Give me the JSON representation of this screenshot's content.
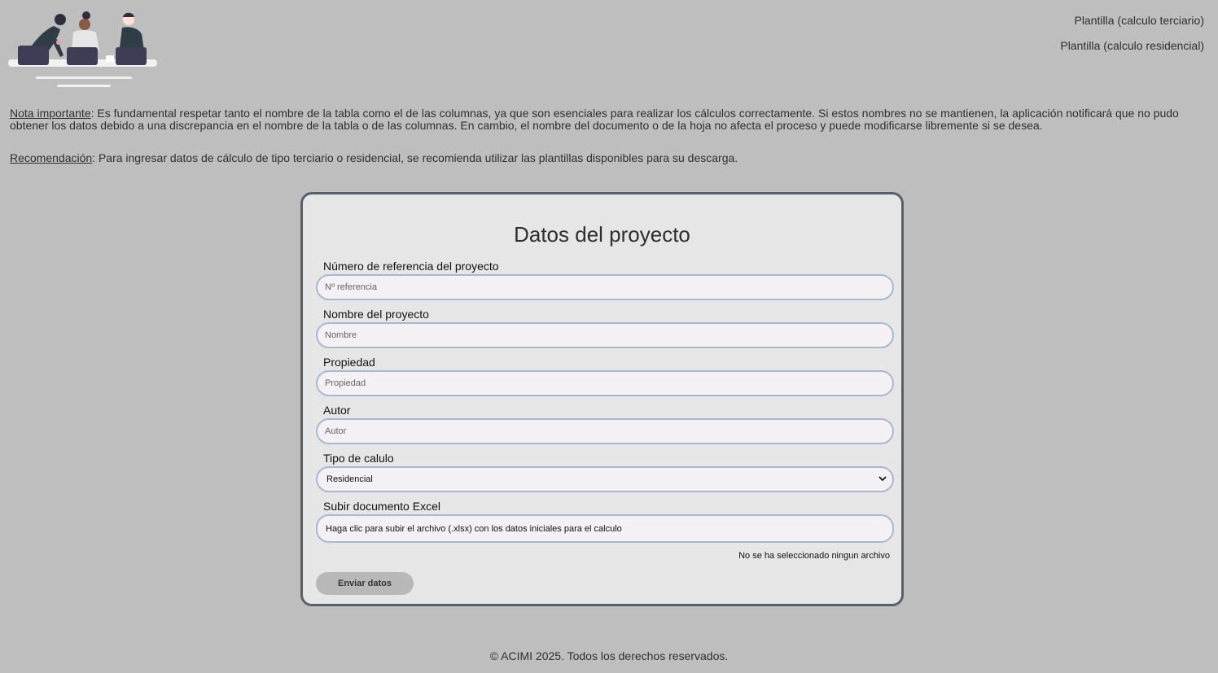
{
  "header": {
    "template_links": [
      "Plantilla (calculo terciario)",
      "Plantilla (calculo residencial)"
    ]
  },
  "notes": {
    "important_label": "Nota importante",
    "important_text": ": Es fundamental respetar tanto el nombre de la tabla como el de las columnas, ya que son esenciales para realizar los cálculos correctamente. Si estos nombres no se mantienen, la aplicación notificará que no pudo obtener los datos debido a una discrepancia en el nombre de la tabla o de las columnas. En cambio, el nombre del documento o de la hoja no afecta el proceso y puede modificarse libremente si se desea.",
    "recommendation_label": "Recomendación",
    "recommendation_text": ": Para ingresar datos de cálculo de tipo terciario o residencial, se recomienda utilizar las plantillas disponibles para su descarga."
  },
  "form": {
    "title": "Datos del proyecto",
    "fields": [
      {
        "label": "Número de referencia del proyecto",
        "placeholder": "Nº referencia",
        "value": ""
      },
      {
        "label": "Nombre del proyecto",
        "placeholder": "Nombre",
        "value": ""
      },
      {
        "label": "Propiedad",
        "placeholder": "Propiedad",
        "value": ""
      },
      {
        "label": "Autor",
        "placeholder": "Autor",
        "value": ""
      }
    ],
    "calc_type": {
      "label": "Tipo de calulo",
      "selected": "Residencial"
    },
    "upload": {
      "label": "Subir documento Excel",
      "prompt": "Haga clic para subir el archivo (.xlsx) con los datos iniciales para el calculo",
      "status": "No se ha seleccionado ningun archivo"
    },
    "submit_label": "Enviar datos"
  },
  "footer": {
    "text": "© ACIMI 2025. Todos los derechos reservados."
  },
  "colors": {
    "background": "#bebebe",
    "card_background": "#e6e6e6",
    "card_border": "#56606e",
    "input_border": "#a9b7cf",
    "input_background": "#f3f1f3"
  }
}
